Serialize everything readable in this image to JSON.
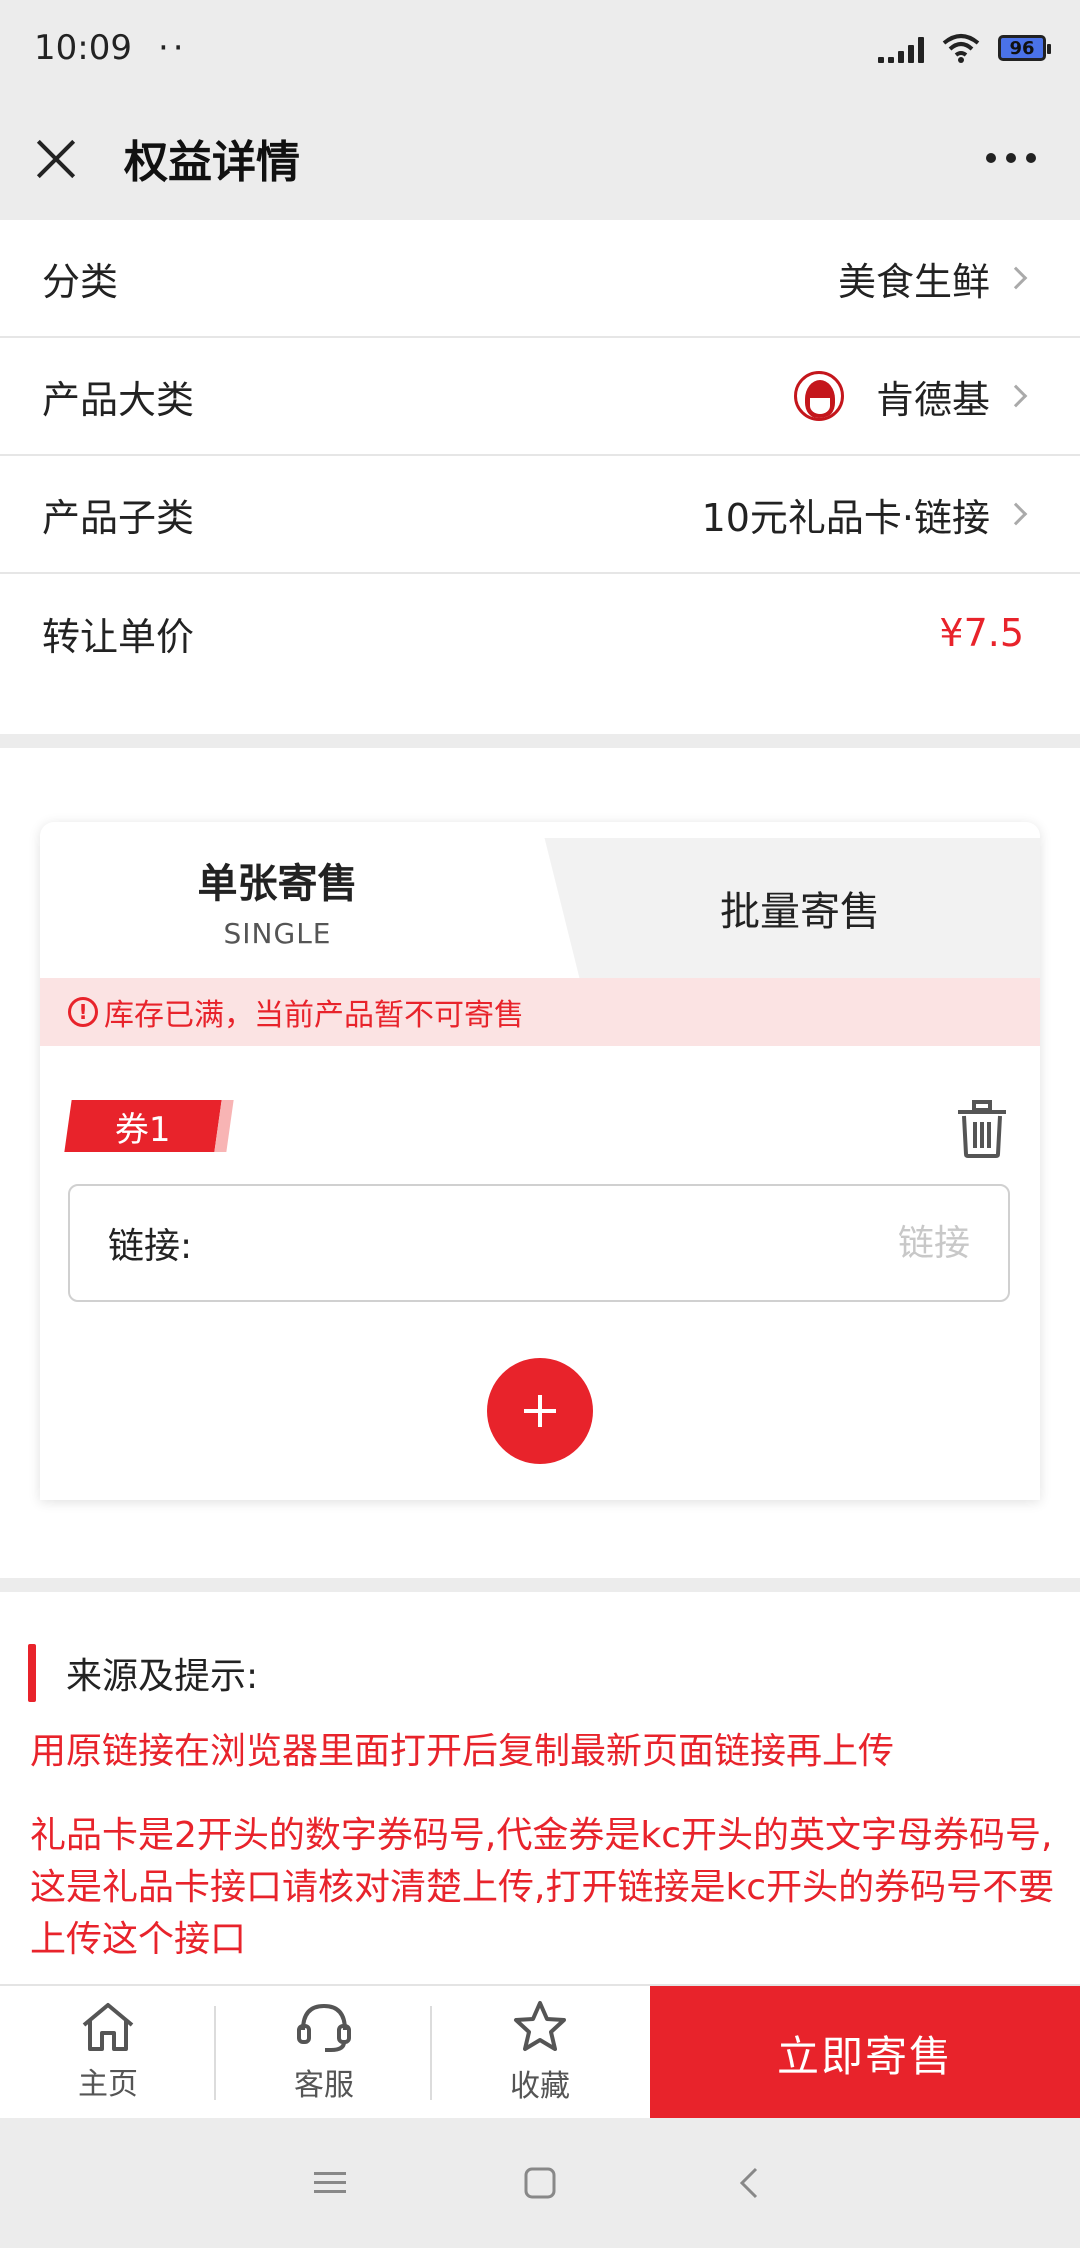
{
  "status": {
    "time": "10:09",
    "dots": "··",
    "battery": "96"
  },
  "nav": {
    "title": "权益详情"
  },
  "info": {
    "category_label": "分类",
    "category_value": "美食生鲜",
    "product_major_label": "产品大类",
    "product_major_value": "肯德基",
    "product_sub_label": "产品子类",
    "product_sub_value": "10元礼品卡·链接",
    "unit_price_label": "转让单价",
    "unit_price_value": "¥7.5"
  },
  "tabs": {
    "single_title": "单张寄售",
    "single_sub": "SINGLE",
    "batch_title": "批量寄售"
  },
  "warning": {
    "icon_text": "!",
    "text": "库存已满，当前产品暂不可寄售"
  },
  "coupon": {
    "tag_label": "券1",
    "link_label": "链接:",
    "link_placeholder": "链接",
    "link_value": ""
  },
  "tips": {
    "title": "来源及提示:",
    "line1": "用原链接在浏览器里面打开后复制最新页面链接再上传",
    "line2": "礼品卡是2开头的数字券码号,代金券是kc开头的英文字母券码号,这是礼品卡接口请核对清楚上传,打开链接是kc开头的券码号不要上传这个接口"
  },
  "bottom": {
    "home_label": "主页",
    "service_label": "客服",
    "favorite_label": "收藏",
    "cta_label": "立即寄售"
  },
  "colors": {
    "accent": "#e8232b",
    "warn_bg": "#fbe3e3",
    "page_bg": "#ececec"
  },
  "icons": [
    "close-icon",
    "more-icon",
    "chevron-right-icon",
    "kfc-logo",
    "warning-icon",
    "trash-icon",
    "plus-icon",
    "home-icon",
    "headset-icon",
    "star-icon",
    "menu-icon",
    "square-icon",
    "back-icon"
  ]
}
